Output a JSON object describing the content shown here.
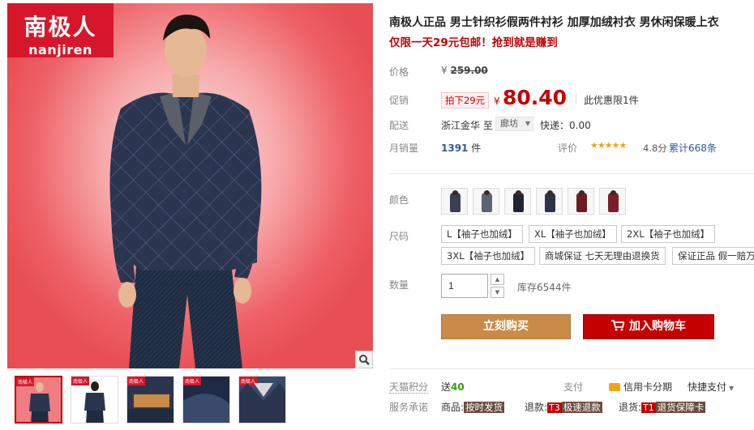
{
  "brand": {
    "logo_cn": "南极人",
    "logo_en": "nanjiren"
  },
  "gallery": {
    "zoom_icon": "magnifier-icon",
    "thumbnails": [
      {
        "kind": "model-front",
        "selected": true
      },
      {
        "kind": "model-back",
        "selected": false
      },
      {
        "kind": "collar-detail",
        "selected": false
      },
      {
        "kind": "fabric-detail",
        "selected": false
      },
      {
        "kind": "shirt-collar",
        "selected": false
      }
    ]
  },
  "product": {
    "title": "南极人正品 男士针织衫假两件衬衫 加厚加绒衬衣 男休闲保暖上衣",
    "promo_line": "仅限一天29元包邮！抢到就是赚到"
  },
  "price": {
    "label": "价格",
    "original_symbol": "¥",
    "original_value": "259.00",
    "promo_label": "促销",
    "promo_badge": "拍下29元",
    "current_symbol": "¥",
    "current_value": "80.40",
    "limit_note": "此优惠限1件"
  },
  "shipping": {
    "label": "配送",
    "from": "浙江金华",
    "to_word": "至",
    "to_city": "廊坊",
    "express": "快递：0.00"
  },
  "sales": {
    "label": "月销量",
    "count": "1391",
    "unit": "件",
    "rating_label": "评价",
    "stars": "★★★★★",
    "score": "4.8分",
    "reviews": "累计668条"
  },
  "colors": {
    "label": "颜色",
    "swatches": [
      {
        "shirt": "#3a3f52"
      },
      {
        "shirt": "#5b6470"
      },
      {
        "shirt": "#1f2433"
      },
      {
        "shirt": "#2c3348"
      },
      {
        "shirt": "#6b1c22"
      },
      {
        "shirt": "#7a1f28"
      }
    ]
  },
  "sizes": {
    "label": "尺码",
    "options": [
      "L【袖子也加绒】",
      "XL【袖子也加绒】",
      "2XL【袖子也加绒】",
      "3XL【袖子也加绒】",
      "商城保证 七天无理由退换货",
      "保证正品 假一赔万"
    ]
  },
  "quantity": {
    "label": "数量",
    "value": "1",
    "stock": "库存6544件",
    "up_icon": "triangle-up-icon",
    "down_icon": "triangle-down-icon"
  },
  "actions": {
    "buy_now": "立刻购买",
    "add_to_cart": "加入购物车",
    "cart_icon": "cart-icon"
  },
  "footer": {
    "points_label": "天猫积分",
    "points_prefix": "送",
    "points_value": "40",
    "pay_label": "支付",
    "card_pay": "信用卡分期",
    "quick_pay": "快捷支付",
    "service_label": "服务承诺",
    "services": [
      {
        "prefix": "商品:",
        "code": "",
        "tag": "按时发货"
      },
      {
        "prefix": "退款:",
        "code": "T3",
        "tag": "极速退款"
      },
      {
        "prefix": "退货:",
        "code": "T1",
        "tag": "退货保障卡"
      }
    ]
  },
  "colors_theme": {
    "accent": "#c40000",
    "buy_button": "#c98b47",
    "cart_button": "#c40000",
    "link": "#2d5a9c",
    "star": "#f2a413",
    "brand_logo": "#d6172b"
  }
}
